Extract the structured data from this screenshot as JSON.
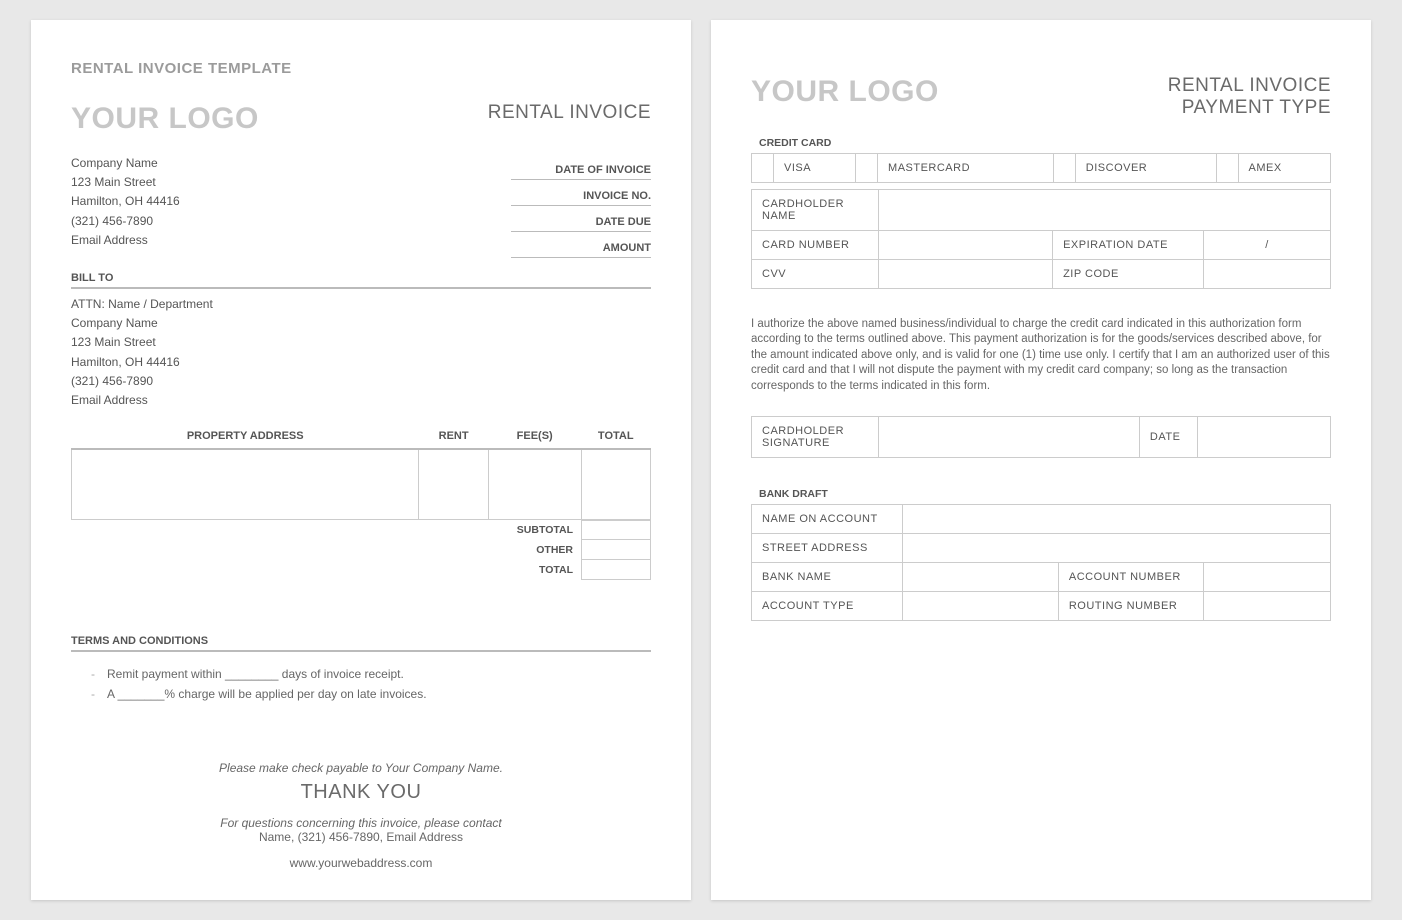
{
  "page1": {
    "template_title": "RENTAL INVOICE TEMPLATE",
    "logo": "YOUR LOGO",
    "doc_title": "RENTAL INVOICE",
    "from": {
      "company": "Company Name",
      "street": "123 Main Street",
      "city": "Hamilton, OH  44416",
      "phone": "(321) 456-7890",
      "email": "Email Address"
    },
    "meta": {
      "date_of_invoice": "DATE OF INVOICE",
      "invoice_no": "INVOICE NO.",
      "date_due": "DATE DUE",
      "amount": "AMOUNT"
    },
    "bill_to_label": "BILL TO",
    "bill_to": {
      "attn": "ATTN: Name / Department",
      "company": "Company Name",
      "street": "123 Main Street",
      "city": "Hamilton, OH  44416",
      "phone": "(321) 456-7890",
      "email": "Email Address"
    },
    "columns": {
      "address": "PROPERTY ADDRESS",
      "rent": "RENT",
      "fees": "FEE(S)",
      "total": "TOTAL"
    },
    "totals": {
      "subtotal": "SUBTOTAL",
      "other": "OTHER",
      "total": "TOTAL"
    },
    "terms_title": "TERMS AND CONDITIONS",
    "terms": {
      "t1": "Remit payment within ________ days of invoice receipt.",
      "t2": "A _______% charge will be applied per day on late invoices."
    },
    "footer": {
      "payable": "Please make check payable to Your Company Name.",
      "thank": "THANK YOU",
      "contact1": "For questions concerning this invoice, please contact",
      "contact2": "Name, (321) 456-7890, Email Address",
      "web": "www.yourwebaddress.com"
    }
  },
  "page2": {
    "logo": "YOUR LOGO",
    "title_line1": "RENTAL INVOICE",
    "title_line2": "PAYMENT TYPE",
    "cc_title": "CREDIT CARD",
    "cards": {
      "visa": "VISA",
      "mc": "MASTERCARD",
      "disc": "DISCOVER",
      "amex": "AMEX"
    },
    "cc": {
      "cardholder": "CARDHOLDER NAME",
      "number": "CARD NUMBER",
      "exp": "EXPIRATION DATE",
      "exp_val": "/",
      "cvv": "CVV",
      "zip": "ZIP CODE"
    },
    "authz": "I authorize the above named business/individual to charge the credit card indicated in this authorization form according to the terms outlined above. This payment authorization is for the goods/services described above, for the amount indicated above only, and is valid for one (1) time use only. I certify that I am an authorized user of this credit card and that I will not dispute the payment with my credit card company; so long as the transaction corresponds to the terms indicated in this form.",
    "sign": {
      "sig": "CARDHOLDER SIGNATURE",
      "date": "DATE"
    },
    "bd_title": "BANK DRAFT",
    "bd": {
      "name": "NAME ON ACCOUNT",
      "street": "STREET ADDRESS",
      "bank": "BANK NAME",
      "acct": "ACCOUNT NUMBER",
      "type": "ACCOUNT TYPE",
      "routing": "ROUTING NUMBER"
    }
  }
}
